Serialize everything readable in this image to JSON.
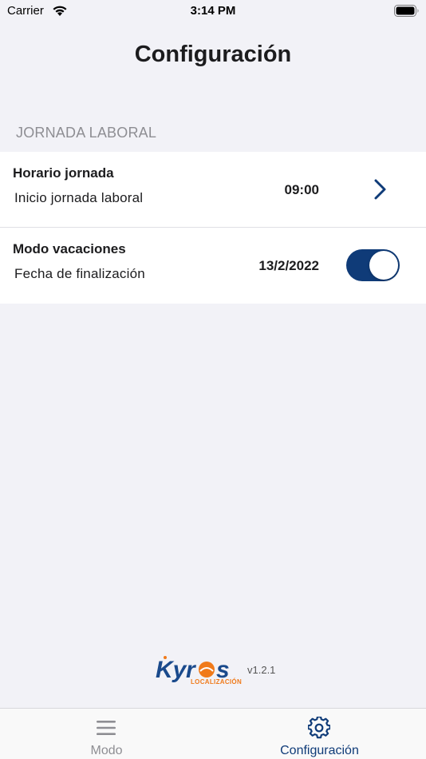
{
  "status_bar": {
    "carrier": "Carrier",
    "time": "3:14 PM",
    "icons": [
      "wifi-icon",
      "battery-icon"
    ]
  },
  "page": {
    "title": "Configuración"
  },
  "section": {
    "header": "JORNADA LABORAL"
  },
  "rows": [
    {
      "title": "Horario jornada",
      "subtitle": "Inicio jornada laboral",
      "value": "09:00",
      "accessory": "chevron-right-icon"
    },
    {
      "title": "Modo vacaciones",
      "subtitle": "Fecha de finalización",
      "value": "13/2/2022",
      "accessory": "toggle",
      "toggle_on": true
    }
  ],
  "brand": {
    "name": "Kyros",
    "tagline": "LOCALIZACIÓN",
    "version": "v1.2.1"
  },
  "tab_bar": {
    "tabs": [
      {
        "label": "Modo",
        "icon": "menu-icon",
        "active": false
      },
      {
        "label": "Configuración",
        "icon": "gear-icon",
        "active": true
      }
    ]
  },
  "colors": {
    "accent": "#0f3b78",
    "background": "#f2f2f7",
    "brand_orange": "#f07a1a",
    "inactive": "#8e8e93"
  }
}
